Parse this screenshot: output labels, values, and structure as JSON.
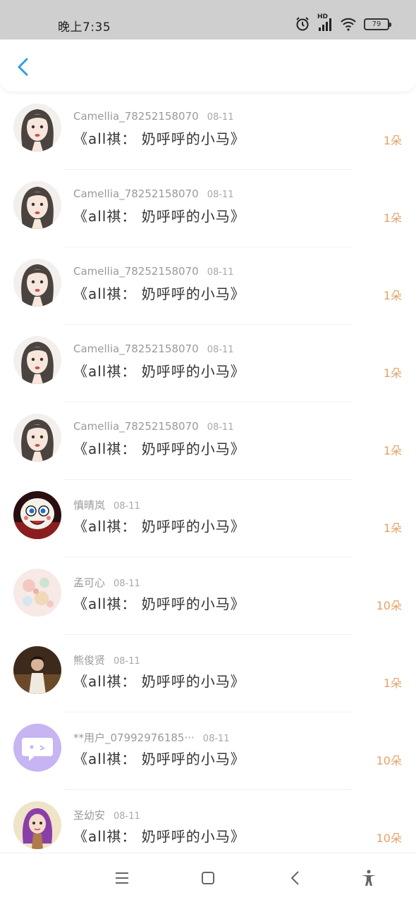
{
  "status_bar": {
    "time": "晚上7:35",
    "network": "HD",
    "battery": "79",
    "icons": [
      "alarm-icon",
      "signal-icon",
      "wifi-icon",
      "battery-icon"
    ]
  },
  "header": {
    "back_icon": "chevron-left-icon",
    "accent_color": "#2a9fe0"
  },
  "list": [
    {
      "user": "Camellia_78252158070",
      "date": "08-11",
      "title": "《all祺： 奶呼呼的小马》",
      "count": "1朵",
      "avatar": "girl-portrait"
    },
    {
      "user": "Camellia_78252158070",
      "date": "08-11",
      "title": "《all祺： 奶呼呼的小马》",
      "count": "1朵",
      "avatar": "girl-portrait"
    },
    {
      "user": "Camellia_78252158070",
      "date": "08-11",
      "title": "《all祺： 奶呼呼的小马》",
      "count": "1朵",
      "avatar": "girl-portrait"
    },
    {
      "user": "Camellia_78252158070",
      "date": "08-11",
      "title": "《all祺： 奶呼呼的小马》",
      "count": "1朵",
      "avatar": "girl-portrait"
    },
    {
      "user": "Camellia_78252158070",
      "date": "08-11",
      "title": "《all祺： 奶呼呼的小马》",
      "count": "1朵",
      "avatar": "girl-portrait"
    },
    {
      "user": "慎晴岚",
      "date": "08-11",
      "title": "《all祺： 奶呼呼的小马》",
      "count": "1朵",
      "avatar": "cartoon-face"
    },
    {
      "user": "孟可心",
      "date": "08-11",
      "title": "《all祺： 奶呼呼的小马》",
      "count": "10朵",
      "avatar": "floral"
    },
    {
      "user": "熊俊贤",
      "date": "08-11",
      "title": "《all祺： 奶呼呼的小马》",
      "count": "1朵",
      "avatar": "photo"
    },
    {
      "user": "**用户_07992976185···",
      "date": "08-11",
      "title": "《all祺： 奶呼呼的小马》",
      "count": "10朵",
      "avatar": "chat-bubble"
    },
    {
      "user": "圣幼安",
      "date": "08-11",
      "title": "《all祺： 奶呼呼的小马》",
      "count": "10朵",
      "avatar": "purple-hair-girl"
    }
  ],
  "nav_bar": {
    "icons": [
      "menu-icon",
      "home-square-icon",
      "back-triangle-icon",
      "accessibility-icon"
    ]
  },
  "colors": {
    "status_bar_bg": "#cfcfcf",
    "count_color": "#e2a266",
    "meta_color": "#9a9a9a",
    "title_color": "#333333"
  }
}
